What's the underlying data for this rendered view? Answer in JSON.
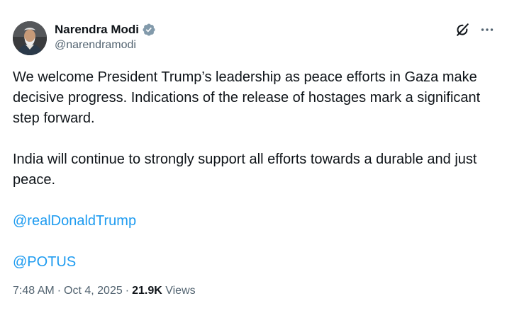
{
  "author": {
    "display_name": "Narendra Modi",
    "handle": "@narendramodi",
    "verified": true,
    "verified_badge_color": "#829aab"
  },
  "icons": {
    "avatar": "profile-photo",
    "verified": "verified-badge-icon",
    "grok": "grok-icon",
    "more": "more-options-icon"
  },
  "post": {
    "paragraph_1": "We welcome President Trump’s leadership as peace efforts in Gaza make decisive progress. Indications of the release of hostages mark a significant step forward.",
    "paragraph_2": "India will continue to strongly support all efforts towards a durable and just peace.",
    "mentions": [
      "@realDonaldTrump",
      "@POTUS"
    ]
  },
  "meta": {
    "time": "7:48 AM",
    "date": "Oct 4, 2025",
    "views_count": "21.9K",
    "views_label": "Views"
  },
  "colors": {
    "text": "#0f1419",
    "secondary": "#536471",
    "link": "#1d9bf0"
  }
}
